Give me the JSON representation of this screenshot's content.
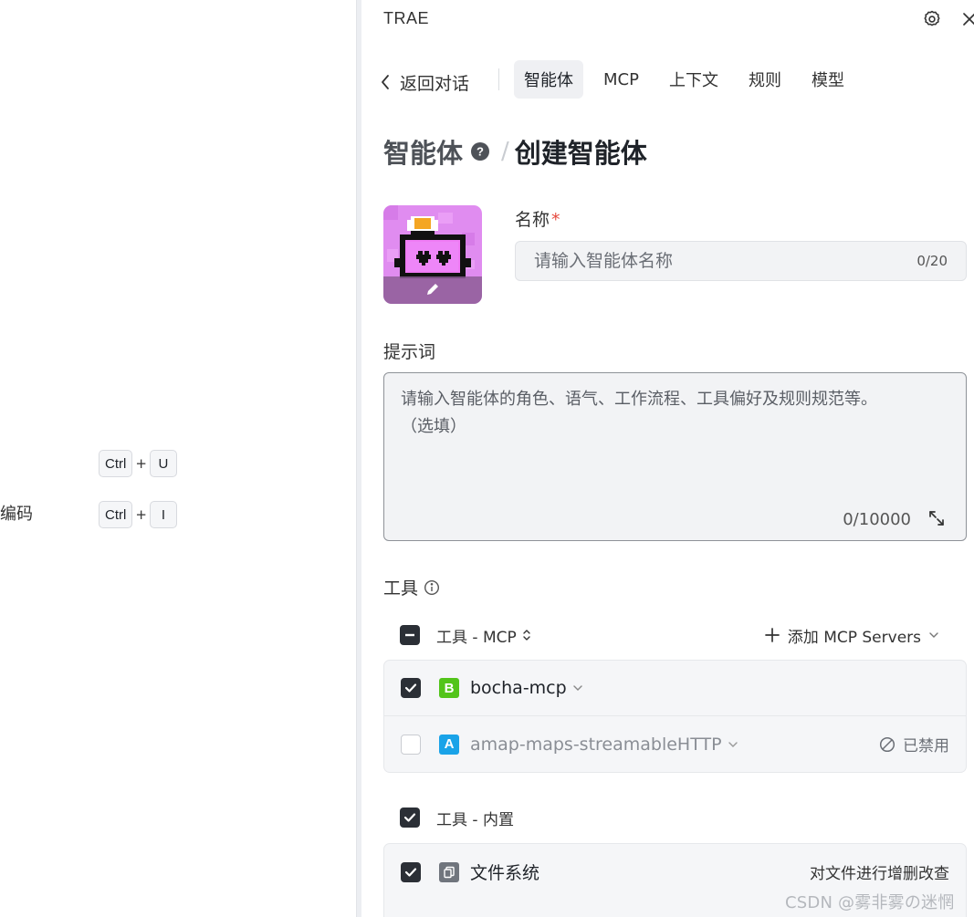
{
  "left_pane": {
    "shortcuts": [
      {
        "label": "",
        "keys": [
          "Ctrl",
          "U"
        ]
      },
      {
        "label": "编码",
        "keys": [
          "Ctrl",
          "I"
        ]
      }
    ]
  },
  "header": {
    "title": "TRAE"
  },
  "nav": {
    "back_label": "返回对话",
    "tabs": [
      {
        "label": "智能体",
        "active": true
      },
      {
        "label": "MCP",
        "active": false
      },
      {
        "label": "上下文",
        "active": false
      },
      {
        "label": "规则",
        "active": false
      },
      {
        "label": "模型",
        "active": false
      }
    ]
  },
  "breadcrumb": {
    "root": "智能体",
    "separator": "/",
    "current": "创建智能体"
  },
  "form": {
    "name_label": "名称",
    "required_mark": "*",
    "name_placeholder": "请输入智能体名称",
    "name_count": "0/20",
    "prompt_label": "提示词",
    "prompt_placeholder": "请输入智能体的角色、语气、工作流程、工具偏好及规则规范等。\n（选填）",
    "prompt_count": "0/10000"
  },
  "tools": {
    "label": "工具",
    "mcp_group": {
      "title": "工具 - MCP",
      "add_label": "添加 MCP Servers",
      "items": [
        {
          "badge": "B",
          "badge_color": "#52c41a",
          "name": "bocha-mcp",
          "checked": true,
          "status": ""
        },
        {
          "badge": "A",
          "badge_color": "#1aa3e8",
          "name": "amap-maps-streamableHTTP",
          "checked": false,
          "status": "已禁用"
        }
      ]
    },
    "builtin_group": {
      "title": "工具 - 内置",
      "items": [
        {
          "name": "文件系统",
          "description": "对文件进行增删改查",
          "checked": true
        }
      ]
    }
  },
  "watermark": "CSDN @雾非雾の迷惘"
}
